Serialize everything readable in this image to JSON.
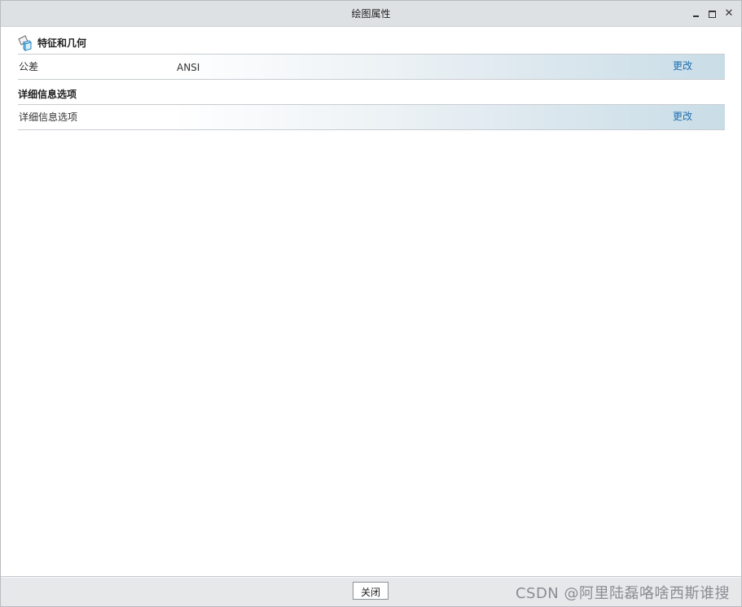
{
  "window": {
    "title": "绘图属性"
  },
  "sections": [
    {
      "header": "特征和几何",
      "icon": "feature-geometry-icon",
      "rows": [
        {
          "label": "公差",
          "value": "ANSI",
          "link": "更改"
        }
      ]
    },
    {
      "header": "详细信息选项",
      "rows": [
        {
          "label": "详细信息选项",
          "value": "",
          "link": "更改"
        }
      ]
    }
  ],
  "footer": {
    "close_label": "关闭",
    "watermark": "CSDN @阿里陆磊咯啥西斯谁搜"
  },
  "colors": {
    "link": "#1f6fb2",
    "title_bar": "#dee1e3",
    "row_gradient_end": "#c9dde7"
  }
}
